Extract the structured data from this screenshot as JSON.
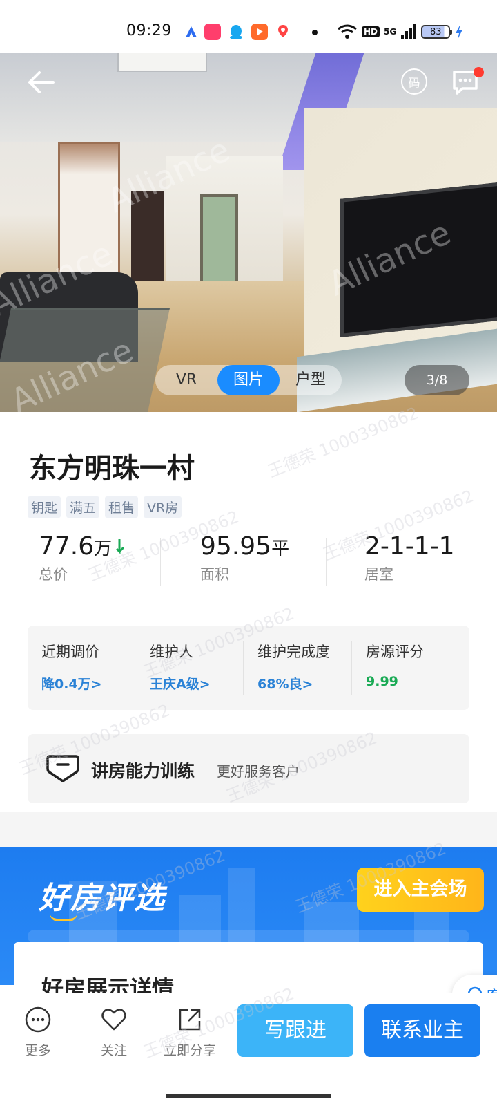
{
  "status_bar": {
    "time": "09:29",
    "network": "5G",
    "hd": "HD",
    "battery": "83"
  },
  "hero": {
    "media_tabs": [
      {
        "label": "VR",
        "active": false
      },
      {
        "label": "图片",
        "active": true
      },
      {
        "label": "户型",
        "active": false
      }
    ],
    "counter": "3/8",
    "code_label": "码",
    "watermark": "Alliance"
  },
  "listing": {
    "title": "东方明珠一村",
    "tags": [
      "钥匙",
      "满五",
      "租售",
      "VR房"
    ],
    "kpis": [
      {
        "value": "77.6",
        "unit": "万",
        "label": "总价",
        "trend": "down"
      },
      {
        "value": "95.95",
        "unit": "平",
        "label": "面积"
      },
      {
        "value": "2-1-1-1",
        "unit": "",
        "label": "居室"
      }
    ]
  },
  "summary": [
    {
      "key": "近期调价",
      "value": "降0.4万>",
      "color": "#2a82d6"
    },
    {
      "key": "维护人",
      "value": "王庆A级>",
      "color": "#2a82d6"
    },
    {
      "key": "维护完成度",
      "value": "68%良>",
      "color": "#2a82d6"
    },
    {
      "key": "房源评分",
      "value": "9.99",
      "color": "#1aaa55"
    }
  ],
  "training": {
    "title": "讲房能力训练",
    "subtitle": "更好服务客户"
  },
  "banner": {
    "title": "好房评选",
    "button": "进入主会场",
    "card_heading": "好房展示详情"
  },
  "float_service": {
    "label": "客"
  },
  "bottom_bar": {
    "items": [
      {
        "label": "更多",
        "icon": "more-icon"
      },
      {
        "label": "关注",
        "icon": "heart-icon"
      },
      {
        "label": "立即分享",
        "icon": "share-icon"
      }
    ],
    "follow_up": "写跟进",
    "contact": "联系业主"
  },
  "watermark": "王德荣 1000390862",
  "colors": {
    "primary": "#1a7ff0",
    "secondary": "#3cb4f8",
    "link": "#2a82d6",
    "score": "#1aaa55",
    "banner_button": "#ffc21c"
  }
}
